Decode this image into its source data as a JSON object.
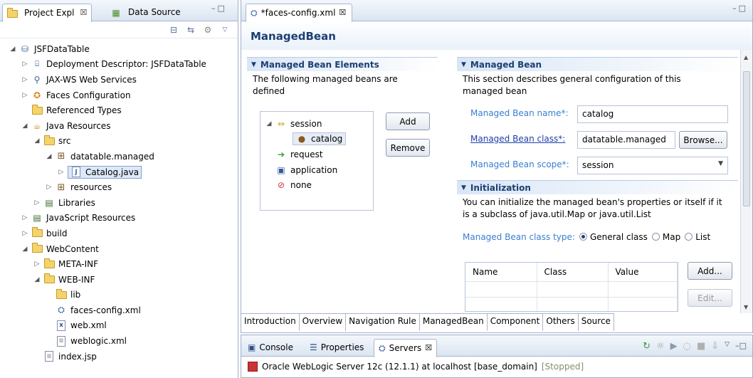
{
  "explorer": {
    "tabs": [
      {
        "label": "Project Expl",
        "close": "☒"
      },
      {
        "label": "Data Source"
      }
    ],
    "minmax": "–□",
    "tree": [
      {
        "label": "JSFDataTable",
        "depth": 0,
        "arrow": "◢",
        "icon": "project-icon"
      },
      {
        "label": "Deployment Descriptor: JSFDataTable",
        "depth": 1,
        "arrow": "▷",
        "icon": "descriptor-icon"
      },
      {
        "label": "JAX-WS Web Services",
        "depth": 1,
        "arrow": "▷",
        "icon": "webservices-icon"
      },
      {
        "label": "Faces Configuration",
        "depth": 1,
        "arrow": "▷",
        "icon": "faces-config-icon"
      },
      {
        "label": "Referenced Types",
        "depth": 1,
        "arrow": "",
        "icon": "folder-icon"
      },
      {
        "label": "Java Resources",
        "depth": 1,
        "arrow": "◢",
        "icon": "java-resources-icon"
      },
      {
        "label": "src",
        "depth": 2,
        "arrow": "◢",
        "icon": "source-folder-icon"
      },
      {
        "label": "datatable.managed",
        "depth": 3,
        "arrow": "◢",
        "icon": "package-icon"
      },
      {
        "label": "Catalog.java",
        "depth": 4,
        "arrow": "▷",
        "icon": "java-file-icon",
        "selected": true
      },
      {
        "label": "resources",
        "depth": 3,
        "arrow": "▷",
        "icon": "package-icon"
      },
      {
        "label": "Libraries",
        "depth": 2,
        "arrow": "▷",
        "icon": "library-icon"
      },
      {
        "label": "JavaScript Resources",
        "depth": 1,
        "arrow": "▷",
        "icon": "library-icon"
      },
      {
        "label": "build",
        "depth": 1,
        "arrow": "▷",
        "icon": "folder-icon"
      },
      {
        "label": "WebContent",
        "depth": 1,
        "arrow": "◢",
        "icon": "folder-icon"
      },
      {
        "label": "META-INF",
        "depth": 2,
        "arrow": "▷",
        "icon": "folder-icon"
      },
      {
        "label": "WEB-INF",
        "depth": 2,
        "arrow": "◢",
        "icon": "folder-icon"
      },
      {
        "label": "lib",
        "depth": 3,
        "arrow": "",
        "icon": "folder-icon"
      },
      {
        "label": "faces-config.xml",
        "depth": 3,
        "arrow": "",
        "icon": "faces-xml-icon"
      },
      {
        "label": "web.xml",
        "depth": 3,
        "arrow": "",
        "icon": "xml-file-icon"
      },
      {
        "label": "weblogic.xml",
        "depth": 3,
        "arrow": "",
        "icon": "weblogic-file-icon"
      },
      {
        "label": "index.jsp",
        "depth": 2,
        "arrow": "",
        "icon": "jsp-file-icon"
      }
    ]
  },
  "editor": {
    "tab_label": "*faces-config.xml",
    "tab_close": "☒",
    "minmax": "–□",
    "title": "ManagedBean",
    "elements_section": {
      "header": "Managed Bean Elements",
      "description": "The following managed beans are defined",
      "tree": [
        {
          "label": "session",
          "arrow": "◢"
        },
        {
          "label": "catalog",
          "arrow": ""
        },
        {
          "label": "request",
          "arrow": ""
        },
        {
          "label": "application",
          "arrow": ""
        },
        {
          "label": "none",
          "arrow": ""
        }
      ],
      "add_label": "Add",
      "remove_label": "Remove"
    },
    "bean_section": {
      "header": "Managed Bean",
      "description": "This section describes general configuration of this managed bean",
      "name_label": "Managed Bean name*:",
      "name_value": "catalog",
      "class_label": "Managed Bean class*:",
      "class_value": "datatable.managed",
      "browse_label": "Browse...",
      "scope_label": "Managed Bean scope*:",
      "scope_value": "session"
    },
    "init_section": {
      "header": "Initialization",
      "description": "You can initialize the managed bean's properties or itself if it is a subclass of java.util.Map or java.util.List",
      "class_type_label": "Managed Bean class type:",
      "options": [
        "General class",
        "Map",
        "List"
      ],
      "selected_option": "General class",
      "columns": [
        "Name",
        "Class",
        "Value"
      ],
      "add_label": "Add...",
      "edit_label": "Edit..."
    },
    "page_tabs": [
      "Introduction",
      "Overview",
      "Navigation Rule",
      "ManagedBean",
      "Component",
      "Others",
      "Source"
    ],
    "active_page_tab": "ManagedBean"
  },
  "bottom": {
    "tabs": [
      {
        "label": "Console"
      },
      {
        "label": "Properties"
      },
      {
        "label": "Servers",
        "close": "☒"
      }
    ],
    "server_name": "Oracle WebLogic Server 12c (12.1.1) at localhost [base_domain]",
    "server_status": "[Stopped]"
  }
}
